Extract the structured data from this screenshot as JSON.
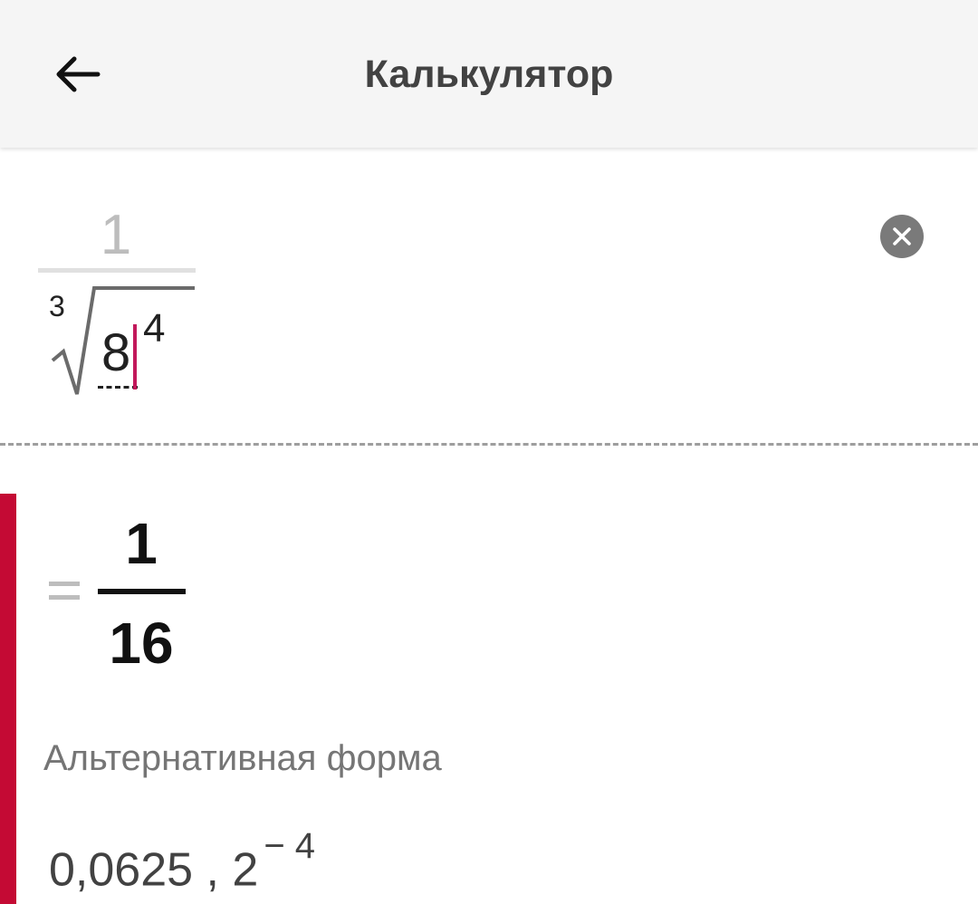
{
  "app_bar": {
    "title": "Калькулятор",
    "back_icon": "arrow-left-icon"
  },
  "expression": {
    "numerator": "1",
    "root_index": "3",
    "radicand": "8",
    "exponent": "4",
    "clear_icon": "close-circle-icon"
  },
  "result": {
    "equals": "=",
    "numerator": "1",
    "denominator": "16"
  },
  "alternative": {
    "label": "Альтернативная форма",
    "decimal": "0,0625",
    "separator": " , ",
    "power_base": "2",
    "power_exponent": "− 4"
  },
  "colors": {
    "accent": "#c40a34",
    "cursor": "#c2185b",
    "app_bar_bg": "#f5f5f5"
  }
}
